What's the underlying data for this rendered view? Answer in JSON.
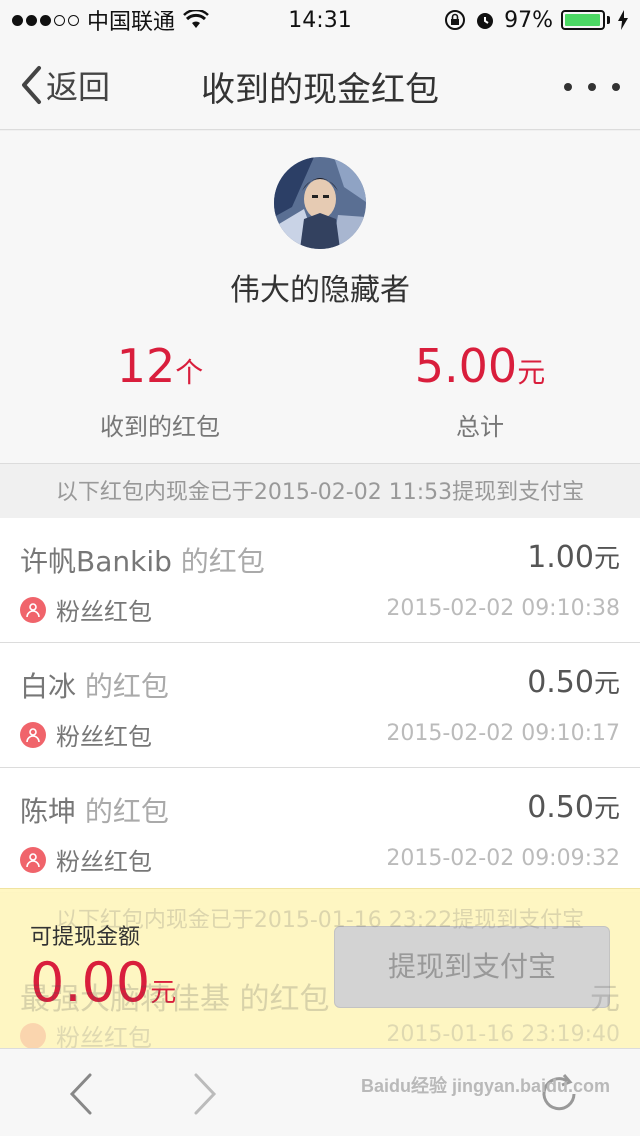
{
  "status_bar": {
    "carrier": "中国联通",
    "time": "14:31",
    "battery": "97%",
    "battery_level": 0.97,
    "signal_bars": 3
  },
  "nav": {
    "back_label": "返回",
    "title": "收到的现金红包"
  },
  "profile": {
    "name": "伟大的隐藏者",
    "received_count": "12",
    "received_unit": "个",
    "received_label": "收到的红包",
    "total_value": "5.00",
    "total_unit": "元",
    "total_label": "总计"
  },
  "section_note": "以下红包内现金已于2015-02-02 11:53提现到支付宝",
  "items": [
    {
      "sender": "许帆Bankib",
      "suffix": " 的红包",
      "amount": "1.00",
      "unit": "元",
      "type": "粉丝红包",
      "time": "2015-02-02 09:10:38"
    },
    {
      "sender": "白冰",
      "suffix": " 的红包",
      "amount": "0.50",
      "unit": "元",
      "type": "粉丝红包",
      "time": "2015-02-02 09:10:17"
    },
    {
      "sender": "陈坤",
      "suffix": " 的红包",
      "amount": "0.50",
      "unit": "元",
      "type": "粉丝红包",
      "time": "2015-02-02 09:09:32"
    }
  ],
  "faded": {
    "note": "以下红包内现金已于2015-01-16 23:22提现到支付宝",
    "sender": "最强大脑蒋佳基 的红包",
    "amount": "元",
    "type": "粉丝红包",
    "time": "2015-01-16 23:19:40"
  },
  "withdraw": {
    "label": "可提现金额",
    "amount": "0.00",
    "unit": "元",
    "button": "提现到支付宝"
  },
  "watermark": "Baidu经验 jingyan.baidu.com",
  "colors": {
    "accent_red": "#d91e3c",
    "battery_green": "#4cd964",
    "panel_yellow": "#fff6be",
    "fan_badge": "#f0646b"
  }
}
